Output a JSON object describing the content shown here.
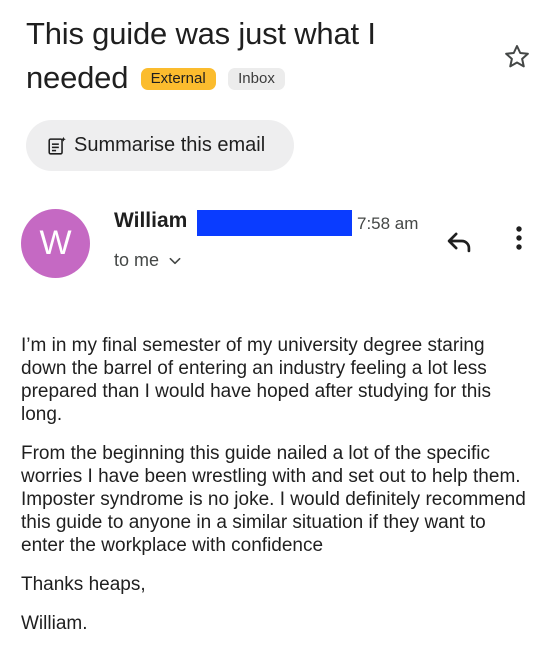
{
  "subject": {
    "title": "This guide was just what I needed",
    "external_label": "External",
    "inbox_label": "Inbox"
  },
  "actions": {
    "summarise_label": "Summarise this email"
  },
  "message": {
    "avatar_letter": "W",
    "sender_name": "William",
    "time": "7:58 am",
    "recipients": "to me",
    "paragraphs": [
      "I’m in my final semester of my university degree staring down the barrel of entering an industry feeling a lot less prepared than I would have hoped after studying for this long.",
      "From the beginning this guide nailed a lot of the specific worries I have been wrestling with and set out to help them. Imposter syndrome is no joke. I would definitely recommend this guide to anyone in a similar situation if they want to enter the workplace with confidence",
      "Thanks heaps,",
      "William."
    ]
  },
  "colors": {
    "avatar": "#c569c3",
    "external_chip": "#fbbc2e",
    "redaction": "#0a3cff"
  },
  "icons": [
    "star-icon",
    "summarise-icon",
    "chevron-down-icon",
    "reply-icon",
    "more-vert-icon"
  ]
}
